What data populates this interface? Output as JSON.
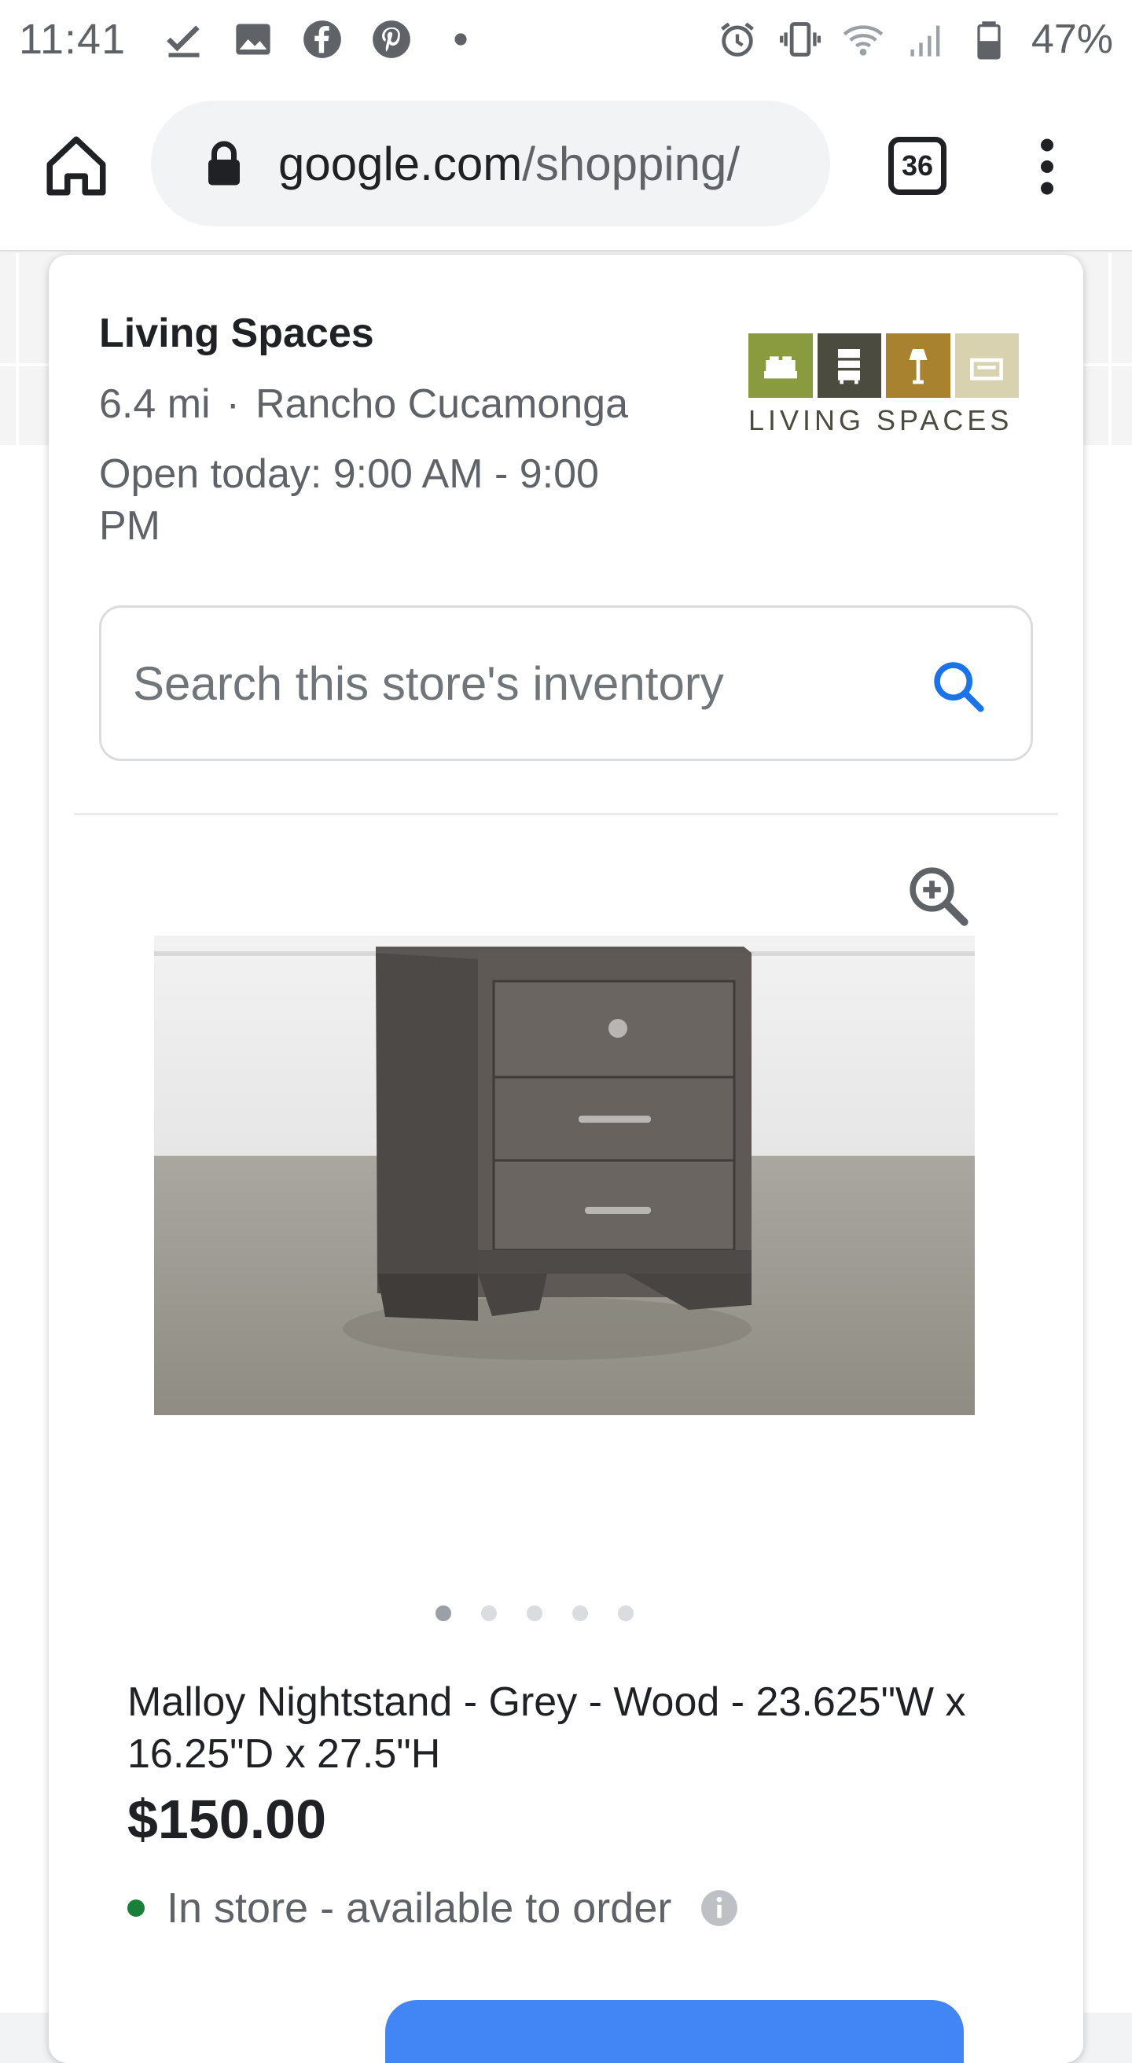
{
  "status_bar": {
    "time": "11:41",
    "battery": "47%",
    "left_icons": [
      "check-download-icon",
      "image-icon",
      "facebook-icon",
      "pinterest-icon",
      "dot-icon"
    ],
    "right_icons": [
      "alarm-icon",
      "vibrate-icon",
      "wifi-icon",
      "signal-icon",
      "battery-icon"
    ]
  },
  "toolbar": {
    "url_host": "google.com",
    "url_path": "/shopping/",
    "tab_count": "36"
  },
  "store": {
    "name": "Living Spaces",
    "distance": "6.4 mi",
    "separator": "·",
    "city": "Rancho Cucamonga",
    "hours": "Open today: 9:00 AM - 9:00 PM",
    "logo_text": "LIVING SPACES"
  },
  "search": {
    "placeholder": "Search this store's inventory"
  },
  "product": {
    "title": "Malloy Nightstand - Grey - Wood - 23.625\"W x 16.25\"D x 27.5\"H",
    "price": "$150.00",
    "availability": "In store - available to order",
    "carousel_total": 5,
    "carousel_active": 1
  },
  "colors": {
    "accent_blue": "#4285f4",
    "in_stock_green": "#188038"
  }
}
